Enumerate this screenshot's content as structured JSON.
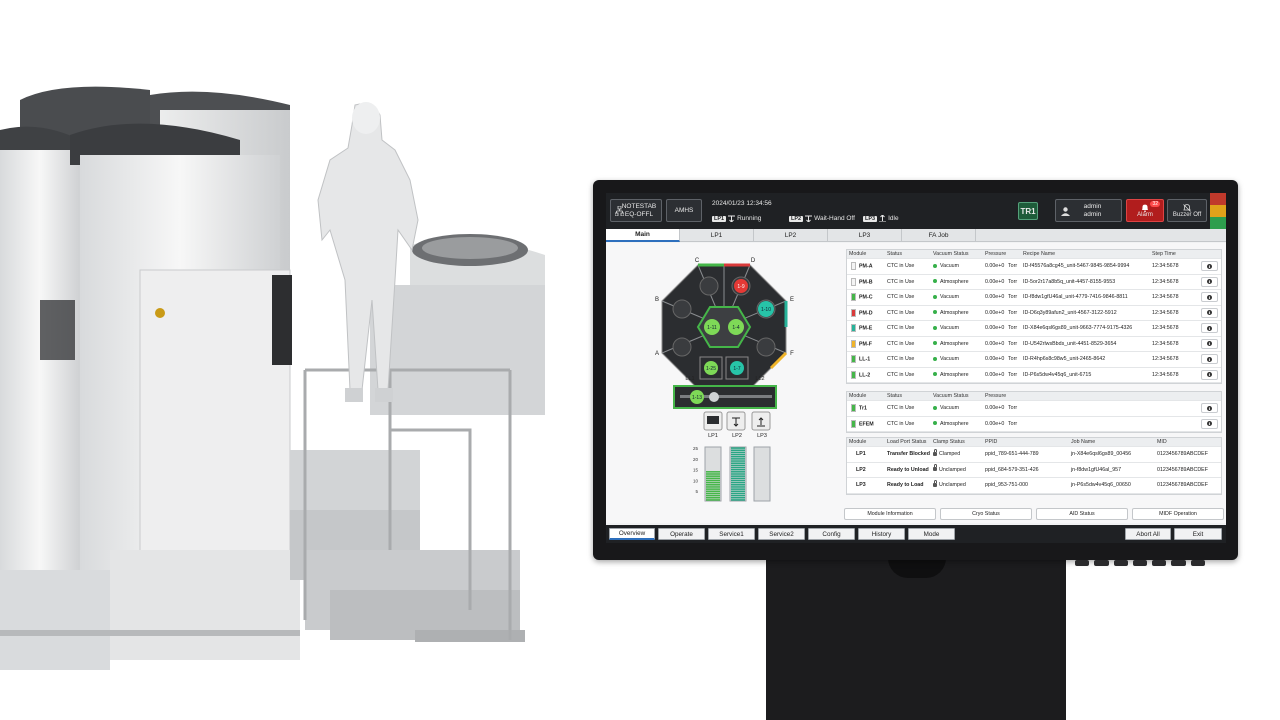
{
  "header": {
    "tool_line1": "NOTESTAB",
    "tool_line2": "EQ-OFFL",
    "amhs": "AMHS",
    "datetime": "2024/01/23 12:34:56",
    "lp_states": [
      {
        "tag": "LP1",
        "state": "Running"
      },
      {
        "tag": "LP2",
        "state": "Wait-Hand Off"
      },
      {
        "tag": "LP3",
        "state": "Idle"
      }
    ],
    "tr_badge": "TR1",
    "user_line1": "admin",
    "user_line2": "admin",
    "alarm_label": "Alarm",
    "alarm_count": "32",
    "buzzer_label": "Buzzer Off",
    "strip_colors": [
      "#c0392b",
      "#e0a21a",
      "#2e9e4d"
    ]
  },
  "tabs": [
    "Main",
    "LP1",
    "LP2",
    "LP3",
    "FA Job"
  ],
  "diagram": {
    "chamber_labels": [
      "C",
      "D",
      "B",
      "E",
      "A",
      "F"
    ],
    "wafer_labels": [
      "1-9",
      "1-11",
      "1-4",
      "1-10",
      "1-25",
      "1-7",
      "1-13"
    ],
    "lock_labels": [
      "LL1",
      "LL2"
    ],
    "port_labels": [
      "LP1",
      "LP2",
      "LP3"
    ],
    "gauge_ticks": [
      "25",
      "20",
      "15",
      "10",
      "5"
    ],
    "lp_fill": [
      0.55,
      1.0,
      0.0
    ]
  },
  "pm_table": {
    "headers": [
      "Module",
      "Status",
      "Vacuum Status",
      "Pressure",
      "Recipe Name",
      "Step Time"
    ],
    "rows": [
      {
        "module": "PM-A",
        "color": "#f4f4f4",
        "status": "CTC in Use",
        "vacuum": "Vacuum",
        "pressure": "0.00e+0",
        "unit": "Torr",
        "recipe": "ID-f45576a8cg45_unit-5467-9845-9854-9994",
        "step": "12:34:5678"
      },
      {
        "module": "PM-B",
        "color": "#f4f4f4",
        "status": "CTC in Use",
        "vacuum": "Atmosphere",
        "pressure": "0.00e+0",
        "unit": "Torr",
        "recipe": "ID-5or2r17a8b5q_unit-4457-8155-9553",
        "step": "12:34:5678"
      },
      {
        "module": "PM-C",
        "color": "#45b649",
        "status": "CTC in Use",
        "vacuum": "Vacuum",
        "pressure": "0.00e+0",
        "unit": "Torr",
        "recipe": "ID-f8dw1gfU46al_unit-4779-7416-9846-8811",
        "step": "12:34:5678"
      },
      {
        "module": "PM-D",
        "color": "#d93a3a",
        "status": "CTC in Use",
        "vacuum": "Atmosphere",
        "pressure": "0.00e+0",
        "unit": "Torr",
        "recipe": "ID-D6q3y89afun2_unit-4567-3122-5912",
        "step": "12:34:5678"
      },
      {
        "module": "PM-E",
        "color": "#27b39a",
        "status": "CTC in Use",
        "vacuum": "Vacuum",
        "pressure": "0.00e+0",
        "unit": "Torr",
        "recipe": "ID-X84e6qsl6gs89_unit-9663-7774-9175-4326",
        "step": "12:34:5678"
      },
      {
        "module": "PM-F",
        "color": "#f0b429",
        "status": "CTC in Use",
        "vacuum": "Atmosphere",
        "pressure": "0.00e+0",
        "unit": "Torr",
        "recipe": "ID-U542rlwsBbds_unit-4451-8529-3654",
        "step": "12:34:5678"
      },
      {
        "module": "LL-1",
        "color": "#45b649",
        "status": "CTC in Use",
        "vacuum": "Vacuum",
        "pressure": "0.00e+0",
        "unit": "Torr",
        "recipe": "ID-R4hp6s8c98w5_unit-2465-8642",
        "step": "12:34:5678"
      },
      {
        "module": "LL-2",
        "color": "#45b649",
        "status": "CTC in Use",
        "vacuum": "Atmosphere",
        "pressure": "0.00e+0",
        "unit": "Torr",
        "recipe": "ID-P6s5dw4v45q6_unit-6715",
        "step": "12:34:5678"
      }
    ]
  },
  "tr_table": {
    "headers": [
      "Module",
      "Status",
      "Vacuum Status",
      "Pressure"
    ],
    "rows": [
      {
        "module": "Tr1",
        "color": "#45b649",
        "status": "CTC in Use",
        "vacuum": "Vacuum",
        "pressure": "0.00e+0",
        "unit": "Torr"
      },
      {
        "module": "EFEM",
        "color": "#45b649",
        "status": "CTC in Use",
        "vacuum": "Atmosphere",
        "pressure": "0.00e+0",
        "unit": "Torr"
      }
    ]
  },
  "lp_table": {
    "headers": [
      "Module",
      "Load Port Status",
      "Clamp Status",
      "PPID",
      "Job Name",
      "MID"
    ],
    "rows": [
      {
        "module": "LP1",
        "status": "Transfer Blocked",
        "clamp": "Clamped",
        "ppid": "ppid_789-651-444-789",
        "job": "jn-X84e6qsl6gs89_00456",
        "mid": "0123456789ABCDEF"
      },
      {
        "module": "LP2",
        "status": "Ready to Unload",
        "clamp": "Unclamped",
        "ppid": "ppid_684-579-351-426",
        "job": "jn-f8dw1gfU46al_957",
        "mid": "0123456789ABCDEF"
      },
      {
        "module": "LP3",
        "status": "Ready to Load",
        "clamp": "Unclamped",
        "ppid": "ppid_953-751-000",
        "job": "jn-P6s5dw4v45q6_00650",
        "mid": "0123456789ABCDEF"
      }
    ]
  },
  "function_buttons": [
    "Module Information",
    "Cryo Status",
    "AID Status",
    "MIDF Operation"
  ],
  "footer": {
    "tabs": [
      "Overview",
      "Operate",
      "Service1",
      "Service2",
      "Config",
      "History",
      "Mode"
    ],
    "right": [
      "Abort All",
      "Exit"
    ]
  }
}
